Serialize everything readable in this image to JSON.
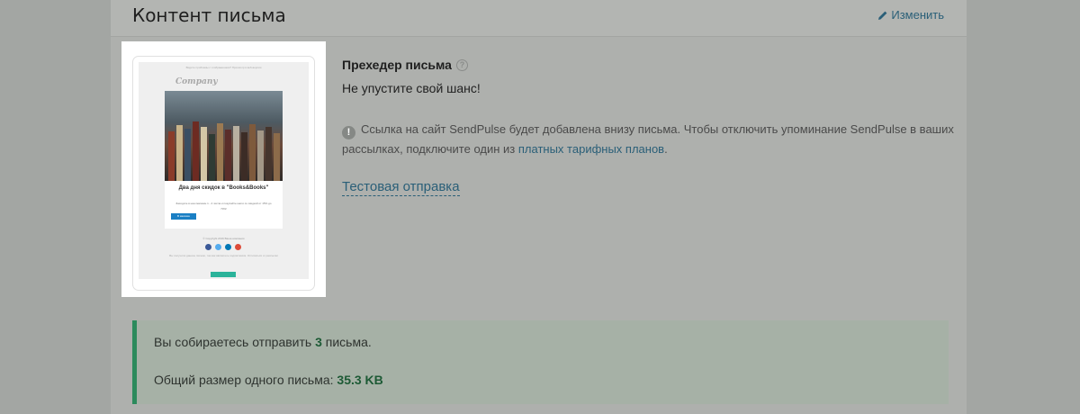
{
  "panel": {
    "title": "Контент письма",
    "edit_label": "Изменить"
  },
  "preview": {
    "top_text": "Видите проблемы с отображением? Просмотр в веб-версии",
    "logo": "Company",
    "headline": "Два дня скидок в \"Books&Books\"",
    "body_text": "Заходите в наш магазин 1 - 4 числа и покупайте книги со скидкой от 15% до 70%!",
    "button": "В магазин",
    "footer": "© Copyright 2016 Ваша компания",
    "footer_small": "Вы получили данное письмо, так как являетесь подписчиком. Отписаться от рассылки",
    "social_colors": [
      "#3b5998",
      "#55acee",
      "#0077b5",
      "#dd4b39"
    ]
  },
  "preheader": {
    "title": "Прехедер письма",
    "text": "Не упустите свой шанс!"
  },
  "notice": {
    "text": "Ссылка на сайт SendPulse будет добавлена внизу письма. Чтобы отключить упоминание SendPulse в ваших рассылках, подключите один из",
    "link": "платных тарифных планов",
    "tail": "."
  },
  "test_send_label": "Тестовая отправка",
  "summary": {
    "line1_prefix": "Вы собираетесь отправить",
    "line1_count": "3",
    "line1_suffix": "письма.",
    "line2_prefix": "Общий размер одного письма:",
    "line2_value": "35.3 KB"
  }
}
